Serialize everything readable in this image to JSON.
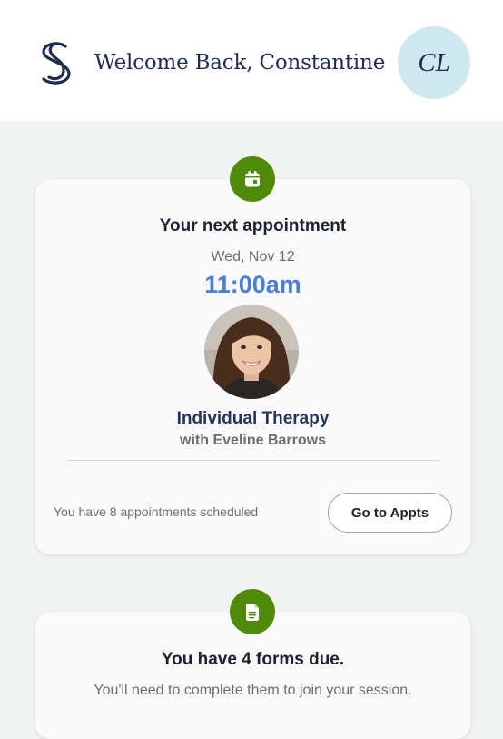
{
  "header": {
    "logo_icon": "s-logo-icon",
    "welcome_text": "Welcome Back, Constantine",
    "avatar_initials": "CL",
    "avatar_color": "#cfe8f0"
  },
  "appointment_card": {
    "badge_icon": "calendar-icon",
    "title": "Your next appointment",
    "date": "Wed, Nov 12",
    "time": "11:00am",
    "therapist_photo": "therapist-photo",
    "service": "Individual Therapy",
    "with_therapist": "with Eveline Barrows",
    "scheduled_text": "You have 8 appointments scheduled",
    "button_label": "Go to Appts"
  },
  "forms_card": {
    "badge_icon": "document-icon",
    "title": "You have 4 forms due.",
    "subtitle": "You'll need to complete them to join your session."
  },
  "colors": {
    "badge_green": "#4f8a0b",
    "time_blue": "#4a7fd8",
    "navy": "#1f2d4d"
  }
}
